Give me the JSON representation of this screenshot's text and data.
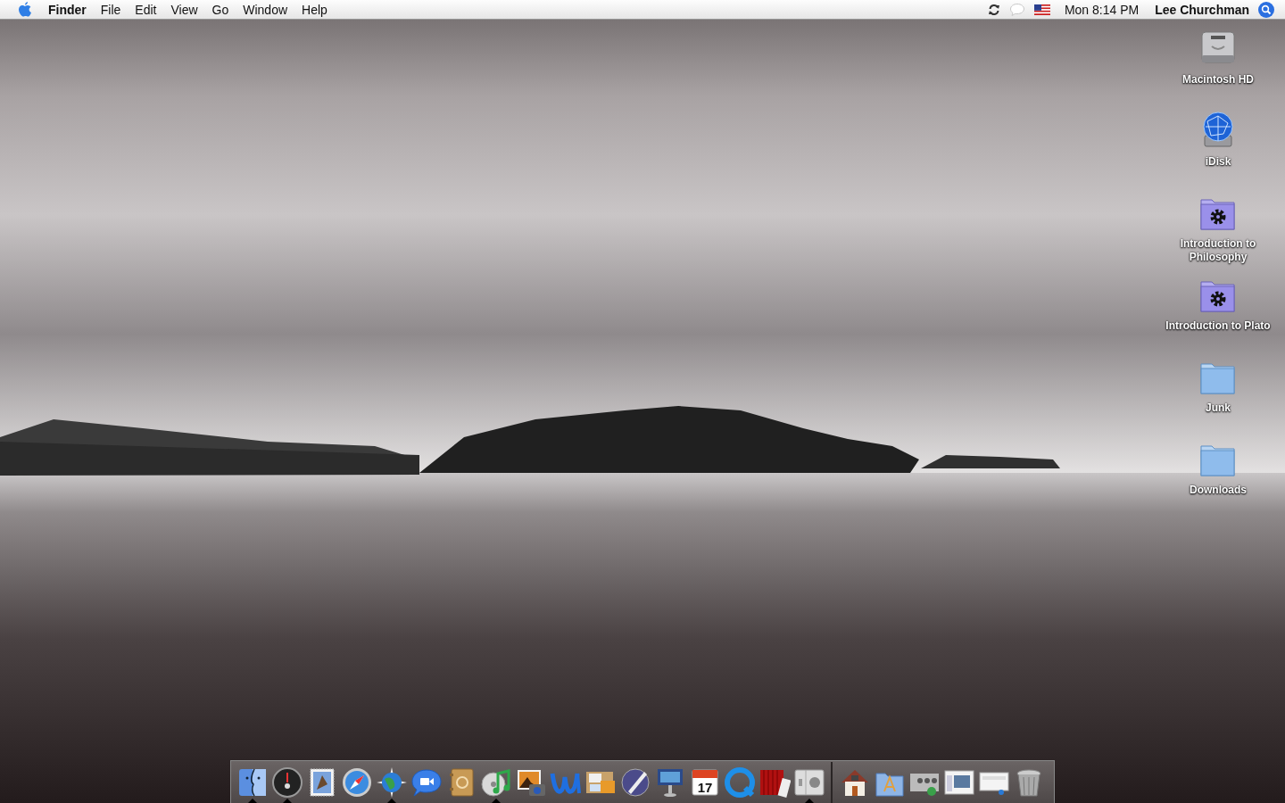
{
  "menu_bar": {
    "menus": [
      {
        "label": "Finder",
        "kind": "app"
      },
      {
        "label": "File",
        "kind": "menu"
      },
      {
        "label": "Edit",
        "kind": "menu"
      },
      {
        "label": "View",
        "kind": "menu"
      },
      {
        "label": "Go",
        "kind": "menu"
      },
      {
        "label": "Window",
        "kind": "menu"
      },
      {
        "label": "Help",
        "kind": "menu"
      }
    ],
    "clock": "Mon 8:14 PM",
    "user": "Lee Churchman"
  },
  "desktop_icons": [
    {
      "label": "Macintosh HD",
      "kind": "disk"
    },
    {
      "label": "iDisk",
      "kind": "idisk"
    },
    {
      "label": "Introduction to Philosophy",
      "kind": "action-folder"
    },
    {
      "label": "Introduction to Plato",
      "kind": "action-folder"
    },
    {
      "label": "Junk",
      "kind": "folder"
    },
    {
      "label": "Downloads",
      "kind": "folder"
    }
  ],
  "dock": {
    "apps": [
      {
        "kind": "finder",
        "running": true
      },
      {
        "kind": "dashboard",
        "running": true
      },
      {
        "kind": "mail",
        "running": false
      },
      {
        "kind": "safari",
        "running": false
      },
      {
        "kind": "globe",
        "running": true
      },
      {
        "kind": "ichat",
        "running": false
      },
      {
        "kind": "addressbook",
        "running": false
      },
      {
        "kind": "itunes",
        "running": true
      },
      {
        "kind": "iphoto",
        "running": false
      },
      {
        "kind": "wave",
        "running": false
      },
      {
        "kind": "collage",
        "running": false
      },
      {
        "kind": "pen",
        "running": false
      },
      {
        "kind": "keynote",
        "running": false
      },
      {
        "kind": "ical",
        "running": false,
        "label": "17"
      },
      {
        "kind": "quicktime",
        "running": false
      },
      {
        "kind": "photobooth",
        "running": false
      },
      {
        "kind": "switch",
        "running": true
      }
    ],
    "others": [
      {
        "kind": "home"
      },
      {
        "kind": "apps-folder"
      },
      {
        "kind": "media"
      },
      {
        "kind": "thumb"
      },
      {
        "kind": "thumb2"
      },
      {
        "kind": "trash"
      }
    ]
  }
}
